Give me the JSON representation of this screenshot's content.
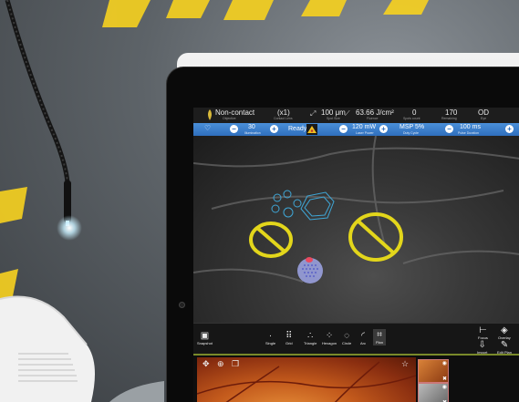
{
  "status_bar": {
    "mode": {
      "value": "Non-contact",
      "label": "Objective"
    },
    "lens": {
      "value": "(x1)",
      "label": "Contact Lens"
    },
    "spot_size": {
      "value": "100 μm",
      "label": "Spot Size"
    },
    "fluence": {
      "value": "63.66 J/cm²",
      "label": "Fluence"
    },
    "spots_count": {
      "value": "0",
      "label": "Spots count"
    },
    "remaining": {
      "value": "170",
      "label": "Remaining"
    },
    "eye": {
      "value": "OD",
      "label": "Eye"
    }
  },
  "control_bar": {
    "illumination": {
      "value": "30",
      "label": "Illumination"
    },
    "ready": "Ready",
    "laser_power": {
      "value": "120 mW",
      "label": "Laser Power"
    },
    "duty_cycle": {
      "value": "MSP 5%",
      "label": "Duty Cycle"
    },
    "pulse_duration": {
      "value": "100 ms",
      "label": "Pulse Duration"
    },
    "minus": "−",
    "plus": "+"
  },
  "toolbar": {
    "snapshot": "Snapshot",
    "patterns": [
      "Single",
      "Grid",
      "Triangle",
      "Hexagon",
      "Circle",
      "Arc",
      "Plan"
    ],
    "focus": "Focus",
    "overlay": "Overlay",
    "import": "Import",
    "edit_plan": "Edit Plan"
  },
  "colors": {
    "blue_bar": "#3b7fcf",
    "no_symbol": "#e3d61b",
    "pattern_outline": "#3fa6d6",
    "watermark": "#f5d22a"
  }
}
